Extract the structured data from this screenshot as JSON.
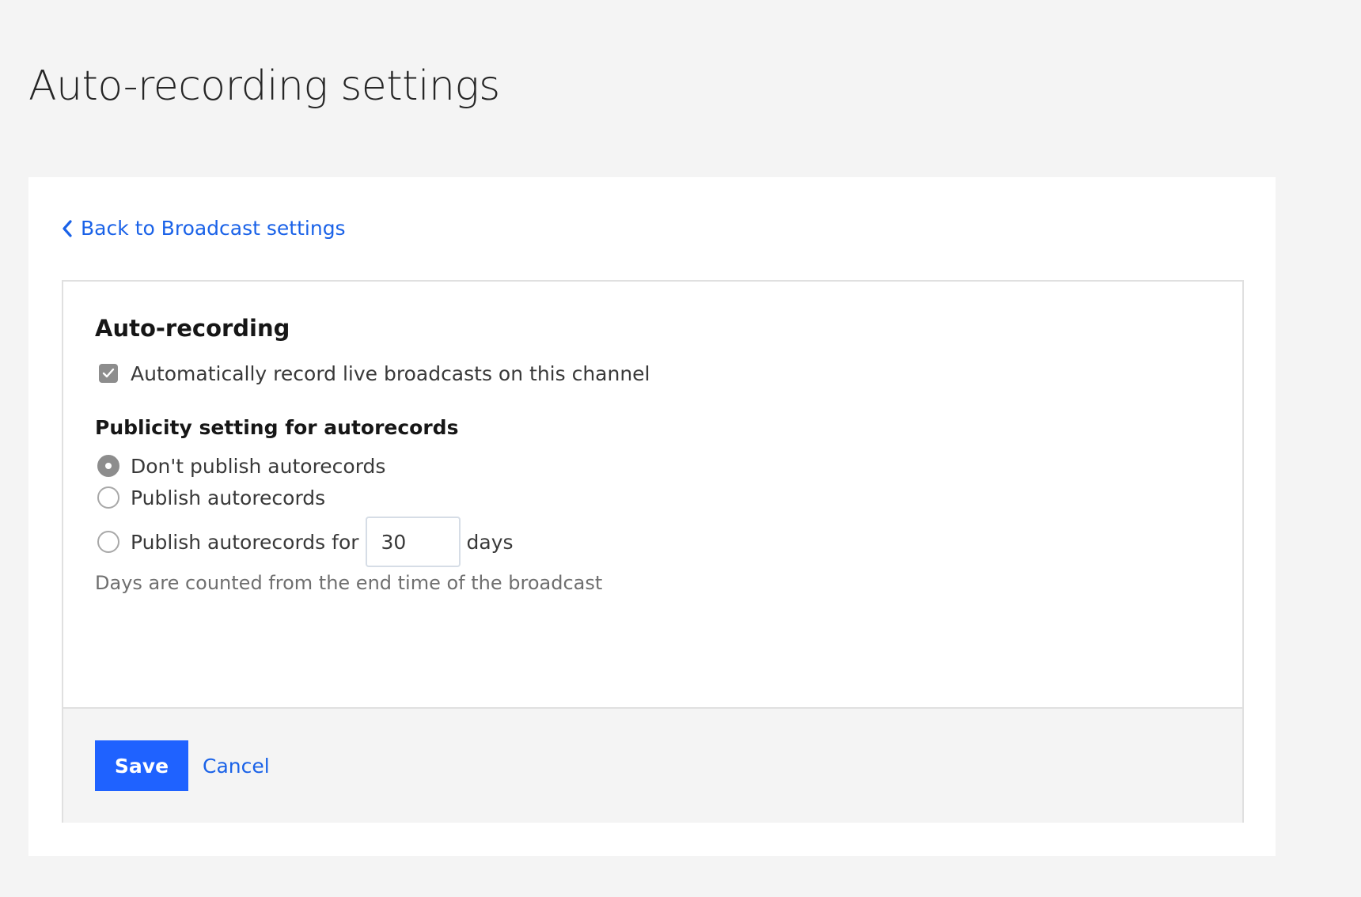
{
  "page": {
    "title": "Auto-recording settings"
  },
  "nav": {
    "back_label": "Back to Broadcast settings",
    "back_icon": "chevron-left-icon"
  },
  "auto_recording": {
    "title": "Auto-recording",
    "checkbox_label": "Automatically record live broadcasts on this channel",
    "checkbox_checked": true
  },
  "publicity": {
    "title": "Publicity setting for autorecords",
    "options": [
      {
        "label": "Don't publish autorecords",
        "selected": true
      },
      {
        "label": "Publish autorecords",
        "selected": false
      },
      {
        "label": "Publish autorecords for",
        "selected": false
      }
    ],
    "days_value": "30",
    "days_suffix": "days",
    "helper_text": "Days are counted from the end time of the broadcast"
  },
  "footer": {
    "save_label": "Save",
    "cancel_label": "Cancel"
  },
  "colors": {
    "accent": "#1f62ff",
    "link": "#1a62e8",
    "background": "#f4f4f4"
  }
}
